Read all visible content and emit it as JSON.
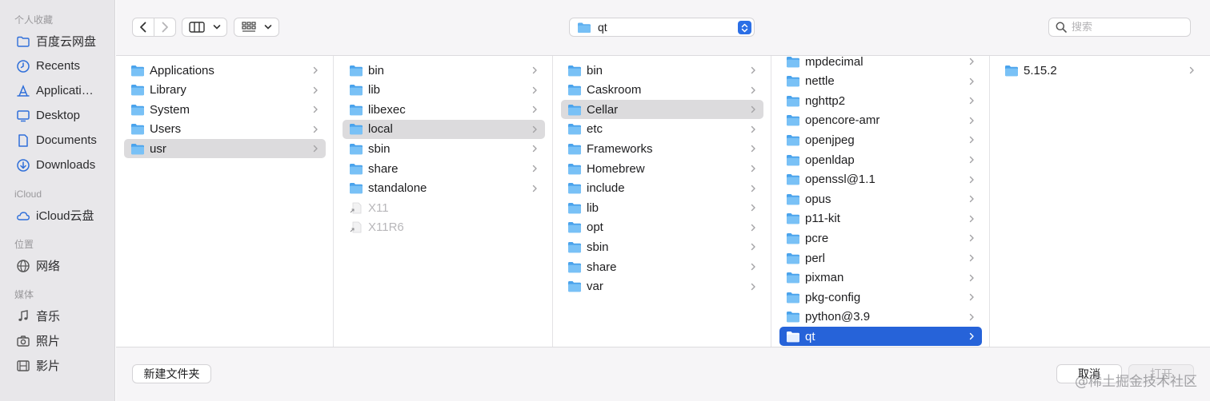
{
  "sidebar": {
    "favorites_title": "个人收藏",
    "favorites": [
      {
        "label": "百度云网盘",
        "icon": "folder-icon"
      },
      {
        "label": "Recents",
        "icon": "clock-icon"
      },
      {
        "label": "Applicati…",
        "icon": "applications-icon"
      },
      {
        "label": "Desktop",
        "icon": "desktop-icon"
      },
      {
        "label": "Documents",
        "icon": "document-icon"
      },
      {
        "label": "Downloads",
        "icon": "downloads-icon"
      }
    ],
    "icloud_title": "iCloud",
    "icloud": [
      {
        "label": "iCloud云盘",
        "icon": "cloud-icon"
      }
    ],
    "locations_title": "位置",
    "locations": [
      {
        "label": "网络",
        "icon": "network-icon"
      }
    ],
    "media_title": "媒体",
    "media": [
      {
        "label": "音乐",
        "icon": "music-icon"
      },
      {
        "label": "照片",
        "icon": "camera-icon"
      },
      {
        "label": "影片",
        "icon": "film-icon"
      }
    ]
  },
  "toolbar": {
    "path_label": "qt",
    "search_placeholder": "搜索"
  },
  "columns": [
    {
      "items": [
        {
          "label": "Applications",
          "state": "normal"
        },
        {
          "label": "Library",
          "state": "normal"
        },
        {
          "label": "System",
          "state": "normal"
        },
        {
          "label": "Users",
          "state": "normal"
        },
        {
          "label": "usr",
          "state": "selected"
        }
      ]
    },
    {
      "items": [
        {
          "label": "bin",
          "state": "normal"
        },
        {
          "label": "lib",
          "state": "normal"
        },
        {
          "label": "libexec",
          "state": "normal"
        },
        {
          "label": "local",
          "state": "selected"
        },
        {
          "label": "sbin",
          "state": "normal"
        },
        {
          "label": "share",
          "state": "normal"
        },
        {
          "label": "standalone",
          "state": "normal"
        },
        {
          "label": "X11",
          "state": "alias"
        },
        {
          "label": "X11R6",
          "state": "alias"
        }
      ]
    },
    {
      "items": [
        {
          "label": "bin",
          "state": "normal"
        },
        {
          "label": "Caskroom",
          "state": "normal"
        },
        {
          "label": "Cellar",
          "state": "selected"
        },
        {
          "label": "etc",
          "state": "normal"
        },
        {
          "label": "Frameworks",
          "state": "normal"
        },
        {
          "label": "Homebrew",
          "state": "normal"
        },
        {
          "label": "include",
          "state": "normal"
        },
        {
          "label": "lib",
          "state": "normal"
        },
        {
          "label": "opt",
          "state": "normal"
        },
        {
          "label": "sbin",
          "state": "normal"
        },
        {
          "label": "share",
          "state": "normal"
        },
        {
          "label": "var",
          "state": "normal"
        }
      ]
    },
    {
      "items": [
        {
          "label": "mpdecimal",
          "state": "normal"
        },
        {
          "label": "nettle",
          "state": "normal"
        },
        {
          "label": "nghttp2",
          "state": "normal"
        },
        {
          "label": "opencore-amr",
          "state": "normal"
        },
        {
          "label": "openjpeg",
          "state": "normal"
        },
        {
          "label": "openldap",
          "state": "normal"
        },
        {
          "label": "openssl@1.1",
          "state": "normal"
        },
        {
          "label": "opus",
          "state": "normal"
        },
        {
          "label": "p11-kit",
          "state": "normal"
        },
        {
          "label": "pcre",
          "state": "normal"
        },
        {
          "label": "perl",
          "state": "normal"
        },
        {
          "label": "pixman",
          "state": "normal"
        },
        {
          "label": "pkg-config",
          "state": "normal"
        },
        {
          "label": "python@3.9",
          "state": "normal"
        },
        {
          "label": "qt",
          "state": "active"
        }
      ]
    },
    {
      "items": [
        {
          "label": "5.15.2",
          "state": "normal"
        }
      ]
    }
  ],
  "bottom": {
    "new_folder": "新建文件夹",
    "cancel": "取消",
    "open": "打开",
    "watermark": "@稀土掘金技术社区"
  },
  "colors": {
    "accent": "#2663d9",
    "folder": "#5fb0f0",
    "folder_dark": "#3d93dd"
  }
}
